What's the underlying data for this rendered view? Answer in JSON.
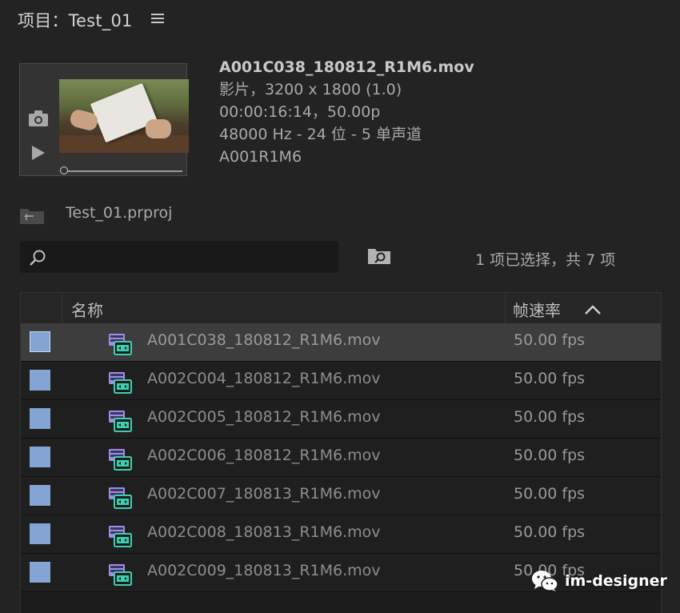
{
  "panel": {
    "title": "项目：Test_01"
  },
  "preview": {
    "clip_name": "A001C038_180812_R1M6.mov",
    "media_info": "影片，3200 x 1800 (1.0)",
    "timecode_info": "00:00:16:14，50.00p",
    "audio_info": "48000 Hz - 24 位 - 5 单声道",
    "reel_name": "A001R1M6"
  },
  "project_file": {
    "name": "Test_01.prproj"
  },
  "search": {
    "value": "",
    "placeholder": ""
  },
  "selection_status": "1 项已选择，共 7 项",
  "list": {
    "columns": [
      "名称",
      "帧速率"
    ],
    "sort_direction": "ascending",
    "rows": [
      {
        "name": "A001C038_180812_R1M6.mov",
        "fps": "50.00 fps",
        "selected": true
      },
      {
        "name": "A002C004_180812_R1M6.mov",
        "fps": "50.00 fps",
        "selected": false
      },
      {
        "name": "A002C005_180812_R1M6.mov",
        "fps": "50.00 fps",
        "selected": false
      },
      {
        "name": "A002C006_180812_R1M6.mov",
        "fps": "50.00 fps",
        "selected": false
      },
      {
        "name": "A002C007_180813_R1M6.mov",
        "fps": "50.00 fps",
        "selected": false
      },
      {
        "name": "A002C008_180813_R1M6.mov",
        "fps": "50.00 fps",
        "selected": false
      },
      {
        "name": "A002C009_180813_R1M6.mov",
        "fps": "50.00 fps",
        "selected": false
      }
    ]
  },
  "watermark": {
    "text": "im-designer"
  },
  "colors": {
    "background": "#232323",
    "label_chip": "#84a4d3",
    "selected_row": "#3d3d3d",
    "clip_icon_purple": "#9b8fe0",
    "clip_icon_teal": "#3ccfb0"
  },
  "icons": {
    "menu": "hamburger-menu-icon",
    "camera": "camera-icon",
    "play": "play-icon",
    "project": "project-bin-icon",
    "search": "search-icon",
    "find_bin": "find-bin-icon",
    "sort": "chevron-up-icon",
    "clip": "video-clip-icon"
  }
}
